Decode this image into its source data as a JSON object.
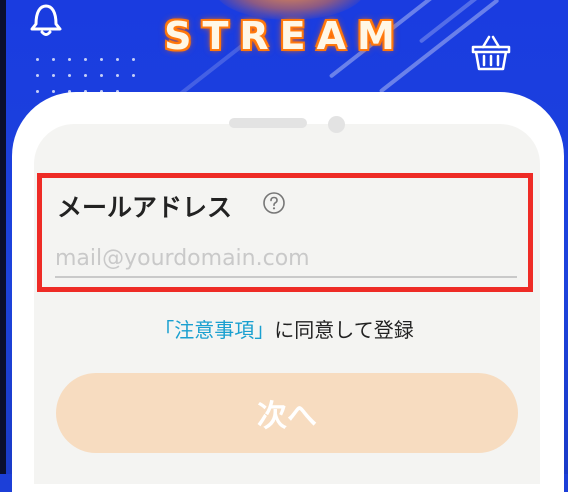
{
  "header": {
    "logo_text": "STREAM",
    "bell_icon": "bell-icon",
    "cart_icon": "basket-icon"
  },
  "form": {
    "email_label": "メールアドレス",
    "help_icon": "question-circle-icon",
    "email_placeholder": "mail@yourdomain.com",
    "email_value": ""
  },
  "consent": {
    "link_text": "「注意事項」",
    "suffix_text": "に同意して登録"
  },
  "next_button": {
    "label": "次へ"
  },
  "colors": {
    "background_blue": "#1d43dc",
    "highlight_border": "#ee2b26",
    "link": "#1aa0d0",
    "button_bg": "#f7dcc0",
    "logo_glow": "#ff7a10"
  }
}
